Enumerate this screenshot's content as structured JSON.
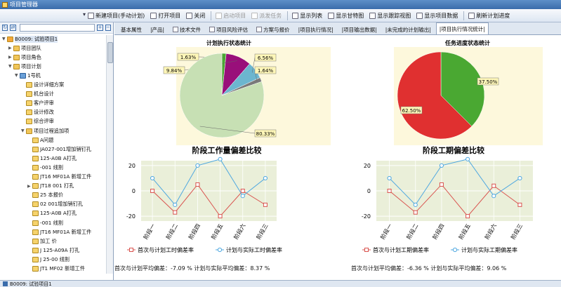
{
  "window": {
    "title": "项目管理器"
  },
  "toolbar": {
    "items": [
      {
        "label": "新建项目(手动计划)",
        "disabled": false,
        "icon": "new-doc-icon"
      },
      {
        "label": "打开项目",
        "disabled": false,
        "icon": "open-folder-icon"
      },
      {
        "label": "关闭",
        "disabled": false,
        "icon": "close-icon"
      },
      {
        "label": "启动项目",
        "disabled": true,
        "icon": "start-icon"
      },
      {
        "label": "派发任务",
        "disabled": true,
        "icon": "dispatch-icon"
      },
      {
        "label": "显示列表",
        "disabled": false,
        "icon": "list-icon"
      },
      {
        "label": "显示甘特图",
        "disabled": false,
        "icon": "gantt-icon"
      },
      {
        "label": "显示跟踪视图",
        "disabled": false,
        "icon": "track-icon"
      },
      {
        "label": "显示项目数据",
        "disabled": false,
        "icon": "data-icon"
      },
      {
        "label": "刷新计划进度",
        "disabled": false,
        "icon": "refresh-icon"
      }
    ]
  },
  "tree": {
    "search_value": "",
    "nodes": [
      {
        "label": "B0009: 试验项目1",
        "level": 0,
        "toggle": "▼",
        "icon": "root",
        "selected": true
      },
      {
        "label": "项目团队",
        "level": 1,
        "toggle": "▶",
        "icon": "folder"
      },
      {
        "label": "项目角色",
        "level": 1,
        "toggle": "▶",
        "icon": "folder"
      },
      {
        "label": "项目计划",
        "level": 1,
        "toggle": "▼",
        "icon": "folder"
      },
      {
        "label": "1号机",
        "level": 2,
        "toggle": "▼",
        "icon": "plan"
      },
      {
        "label": "设计详细方案",
        "level": 3,
        "toggle": "",
        "icon": "task"
      },
      {
        "label": "机台设计",
        "level": 3,
        "toggle": "",
        "icon": "task"
      },
      {
        "label": "客户评审",
        "level": 3,
        "toggle": "",
        "icon": "task"
      },
      {
        "label": "设计修改",
        "level": 3,
        "toggle": "",
        "icon": "task"
      },
      {
        "label": "综合评审",
        "level": 3,
        "toggle": "",
        "icon": "task"
      },
      {
        "label": "项目过程追加项",
        "level": 3,
        "toggle": "▼",
        "icon": "folder"
      },
      {
        "label": "A问题",
        "level": 4,
        "toggle": "",
        "icon": "task"
      },
      {
        "label": "JA027-001增加销钉孔",
        "level": 4,
        "toggle": "",
        "icon": "task"
      },
      {
        "label": "125-A0B A打孔",
        "level": 4,
        "toggle": "",
        "icon": "task"
      },
      {
        "label": "-001 线割",
        "level": 4,
        "toggle": "",
        "icon": "task"
      },
      {
        "label": "JT16 MF01A 新增工件",
        "level": 4,
        "toggle": "",
        "icon": "task"
      },
      {
        "label": "JT18 001 打孔",
        "level": 4,
        "toggle": "▶",
        "icon": "task"
      },
      {
        "label": "25 本报价",
        "level": 4,
        "toggle": "",
        "icon": "task"
      },
      {
        "label": "02 001增加销钉孔",
        "level": 4,
        "toggle": "",
        "icon": "task"
      },
      {
        "label": "125-A0B A打孔",
        "level": 4,
        "toggle": "",
        "icon": "task"
      },
      {
        "label": "-001 线割",
        "level": 4,
        "toggle": "",
        "icon": "task"
      },
      {
        "label": "JT16 MF01A 新增工件",
        "level": 4,
        "toggle": "",
        "icon": "task"
      },
      {
        "label": "加工 价",
        "level": 4,
        "toggle": "",
        "icon": "task"
      },
      {
        "label": "J 125-A09A 打孔",
        "level": 4,
        "toggle": "",
        "icon": "task"
      },
      {
        "label": "J 25-00 线割",
        "level": 4,
        "toggle": "",
        "icon": "task"
      },
      {
        "label": "JT1 MF02 新增工件",
        "level": 4,
        "toggle": "",
        "icon": "task"
      }
    ]
  },
  "tabs": [
    {
      "label": "基本属性",
      "icon": "",
      "active": false
    },
    {
      "label": "|产品|",
      "icon": "",
      "active": false
    },
    {
      "label": "技术文件",
      "icon": "doc-icon",
      "active": false
    },
    {
      "label": "项目风险评估",
      "icon": "risk-icon",
      "active": false
    },
    {
      "label": "方案与报价",
      "icon": "quote-icon",
      "active": false
    },
    {
      "label": "|项目执行情况|",
      "icon": "",
      "active": false
    },
    {
      "label": "|项目输出数据|",
      "icon": "",
      "active": false
    },
    {
      "label": "|未完成的计划输出|",
      "icon": "",
      "active": false
    },
    {
      "label": "|项目执行情况统计|",
      "icon": "",
      "active": true
    }
  ],
  "chart_data": [
    {
      "type": "pie",
      "title": "计划执行状态统计",
      "labels": [
        "1.63%",
        "9.84%",
        "6.56%",
        "1.64%",
        "80.33%"
      ],
      "values": [
        1.63,
        9.84,
        6.56,
        1.64,
        80.33
      ],
      "colors": [
        "#4aa832",
        "#990f7a",
        "#6cb6cf",
        "#7a7a7a",
        "#c7e0b4"
      ]
    },
    {
      "type": "pie",
      "title": "任务进度状态统计",
      "labels": [
        "37.50%",
        "62.50%"
      ],
      "values": [
        37.5,
        62.5
      ],
      "colors": [
        "#4aa832",
        "#e03030"
      ]
    },
    {
      "type": "line",
      "title": "阶段工作量偏差比较",
      "categories": [
        "阶段一",
        "阶段二",
        "阶段四",
        "阶段五",
        "阶段六",
        "阶段三"
      ],
      "ylim": [
        -20,
        20
      ],
      "yticks": [
        20,
        0,
        -20
      ],
      "series": [
        {
          "name": "首次与计划工时偏差率",
          "color": "#d9534f",
          "marker": "square",
          "values": [
            0,
            -17,
            5,
            -20,
            0,
            -11
          ]
        },
        {
          "name": "计划与实际工时偏差率",
          "color": "#4fa8e0",
          "marker": "circle",
          "values": [
            10,
            -11,
            20,
            25,
            -4,
            10
          ]
        }
      ]
    },
    {
      "type": "line",
      "title": "阶段工期偏差比较",
      "categories": [
        "阶段一",
        "阶段二",
        "阶段四",
        "阶段五",
        "阶段六",
        "阶段三"
      ],
      "ylim": [
        -20,
        20
      ],
      "yticks": [
        20,
        0,
        -20
      ],
      "series": [
        {
          "name": "首次与计划工期偏差率",
          "color": "#d9534f",
          "marker": "square",
          "values": [
            0,
            -17,
            5,
            -20,
            4,
            -11
          ]
        },
        {
          "name": "计划与实际工期偏差率",
          "color": "#4fa8e0",
          "marker": "circle",
          "values": [
            10,
            -11,
            20,
            25,
            -4,
            10
          ]
        }
      ]
    }
  ],
  "summaries": {
    "left": "首次与计划平均偏差：-7.09 %   计划与实际平均偏差：8.37 %",
    "right": "首次与计划平均偏差：-6.36 %   计划与实际平均偏差：9.06 %"
  },
  "status": {
    "text": "B0009: 试验项目1"
  }
}
